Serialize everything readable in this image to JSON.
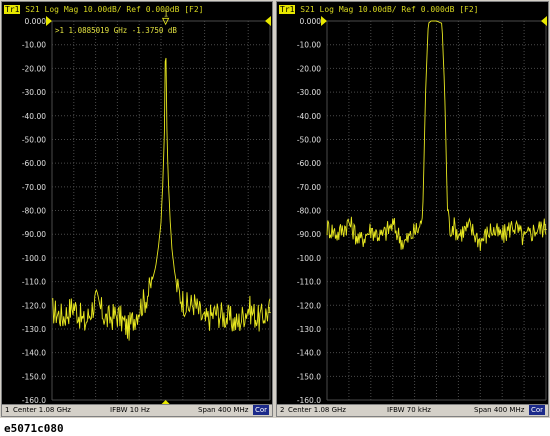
{
  "panels": [
    {
      "header": {
        "trace_label": "Tr1",
        "text": "S21 Log Mag 10.00dB/ Ref 0.000dB [F2]"
      },
      "marker_readout": ">1  1.0885019 GHz -1.3750 dB",
      "marker_number": "1",
      "trace_end_label": "1",
      "footer": {
        "channel": "1",
        "center": "Center 1.08 GHz",
        "ifbw": "IFBW 10 Hz",
        "span": "Span 400 MHz",
        "cor": "Cor"
      },
      "y_ticks": [
        "0.000",
        "-10.00",
        "-20.00",
        "-30.00",
        "-40.00",
        "-50.00",
        "-60.00",
        "-70.00",
        "-80.00",
        "-90.00",
        "-100.0",
        "-110.0",
        "-120.0",
        "-130.0",
        "-140.0",
        "-150.0",
        "-160.0"
      ]
    },
    {
      "header": {
        "trace_label": "Tr1",
        "text": "S21 Log Mag 10.00dB/ Ref 0.000dB [F2]"
      },
      "footer": {
        "channel": "2",
        "center": "Center 1.08 GHz",
        "ifbw": "IFBW 70 kHz",
        "span": "Span 400 MHz",
        "cor": "Cor"
      },
      "trace_end_label": "1",
      "y_ticks": [
        "0.000",
        "-10.00",
        "-20.00",
        "-30.00",
        "-40.00",
        "-50.00",
        "-60.00",
        "-70.00",
        "-80.00",
        "-90.00",
        "-100.0",
        "-110.0",
        "-120.0",
        "-130.0",
        "-140.0",
        "-150.0",
        "-160.0"
      ]
    }
  ],
  "caption": "e5071c080",
  "colors": {
    "trace": "#e8e820",
    "grid": "#4a4a4a",
    "background": "#000000",
    "cor_badge": "#1c2a8a"
  },
  "chart_data": [
    {
      "type": "line",
      "title": "S21 Log Mag 10.00dB/ Ref 0.000dB [F2]",
      "xlabel": "",
      "ylabel": "",
      "ylim": [
        -160,
        0
      ],
      "xlim_ghz": [
        0.88,
        1.28
      ],
      "grid": true,
      "series": [
        {
          "x": [
            0.88,
            0.9,
            0.92,
            0.94,
            0.96,
            0.98,
            1.0,
            1.02,
            1.04,
            1.05,
            1.06,
            1.07,
            1.075,
            1.08,
            1.083,
            1.086,
            1.0885,
            1.091,
            1.094,
            1.097,
            1.1,
            1.105,
            1.11,
            1.12,
            1.13,
            1.14,
            1.16,
            1.18,
            1.2,
            1.22,
            1.24,
            1.26,
            1.28
          ],
          "values": [
            -122,
            -125,
            -120,
            -128,
            -118,
            -126,
            -124,
            -130,
            -121,
            -118,
            -113,
            -104,
            -96,
            -85,
            -70,
            -50,
            -1.4,
            -50,
            -70,
            -85,
            -96,
            -106,
            -113,
            -118,
            -121,
            -119,
            -127,
            -123,
            -125,
            -128,
            -121,
            -126,
            -122
          ]
        }
      ]
    },
    {
      "type": "line",
      "title": "S21 Log Mag 10.00dB/ Ref 0.000dB [F2]",
      "xlabel": "",
      "ylabel": "",
      "ylim": [
        -160,
        0
      ],
      "xlim_ghz": [
        0.88,
        1.28
      ],
      "grid": true,
      "series": [
        {
          "x": [
            0.88,
            0.9,
            0.92,
            0.94,
            0.96,
            0.98,
            1.0,
            1.02,
            1.04,
            1.05,
            1.055,
            1.06,
            1.065,
            1.07,
            1.08,
            1.09,
            1.095,
            1.1,
            1.105,
            1.11,
            1.12,
            1.14,
            1.16,
            1.18,
            1.2,
            1.22,
            1.24,
            1.26,
            1.28
          ],
          "values": [
            -87,
            -90,
            -85,
            -93,
            -88,
            -91,
            -86,
            -94,
            -89,
            -87,
            -80,
            -30,
            -1,
            0,
            0,
            -1,
            -30,
            -80,
            -88,
            -86,
            -90,
            -87,
            -93,
            -88,
            -91,
            -86,
            -92,
            -88,
            -87
          ]
        }
      ]
    }
  ]
}
